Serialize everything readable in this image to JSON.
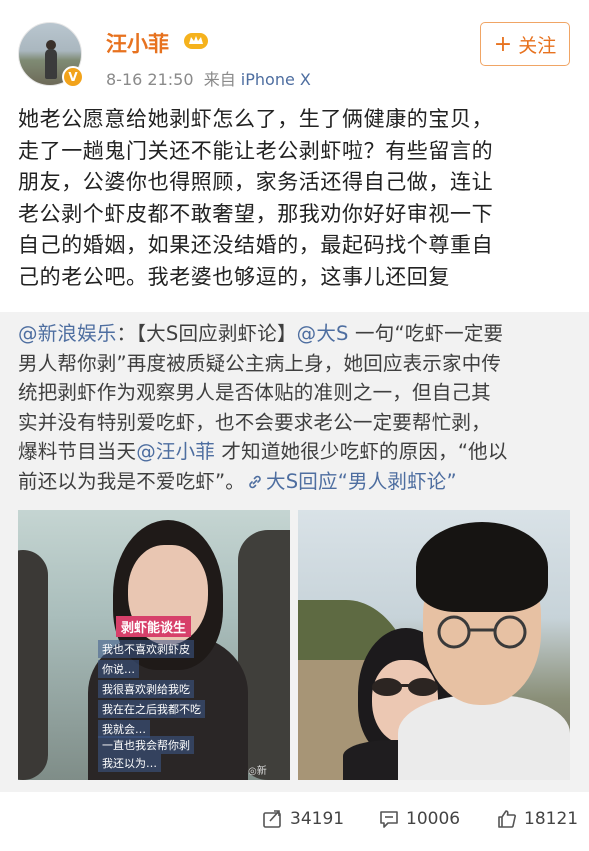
{
  "post": {
    "username": "汪小菲",
    "time": "8-16 21:50",
    "source_prefix": "来自",
    "source": "iPhone X",
    "follow_label": "关注",
    "text_lines": [
      "她老公愿意给她剥虾怎么了，生了俩健康的宝贝，",
      "走了一趟鬼门关还不能让老公剥虾啦？有些留言的",
      "朋友，公婆你也得照顾，家务活还得自己做，连让",
      "老公剥个虾皮都不敢奢望，那我劝你好好审视一下",
      "自己的婚姻，如果还没结婚的，最起码找个尊重自",
      "己的老公吧。我老婆也够逗的，这事儿还回复"
    ]
  },
  "retweet": {
    "author": "@新浪娱乐",
    "colon": "：【大S回应剥虾论】",
    "mention_1": "@大S",
    "seg_1": " 一句“吃虾一定要",
    "line_2": "男人帮你剥”再度被质疑公主病上身，她回应表示家中传",
    "line_3": "统把剥虾作为观察男人是否体贴的准则之一，但自己其",
    "line_4": "实并没有特别爱吃虾，也不会要求老公一定要帮忙剥，",
    "line_5_a": "爆料节目当天",
    "mention_2": "@汪小菲",
    "line_5_b": " 才知道她很少吃虾的原因，“他以",
    "line_6_a": "前还以为我是不爱吃虾”。",
    "topic_link": "大S回应“男人剥虾论”",
    "image_left": {
      "pink_caption": "剥虾能谈生",
      "subtitles": [
        "我也不喜欢剥虾皮",
        "你说…",
        "我很喜欢剥给我吃",
        "我在在之后我都不吃",
        "我就会…",
        "一直也我会帮你剥",
        "我还以为…"
      ],
      "watermark": "◎新"
    }
  },
  "footer": {
    "repost_count": "34191",
    "comment_count": "10006",
    "like_count": "18121"
  },
  "colors": {
    "username": "#e7721f",
    "link": "#4e6ea0",
    "retweet_bg": "#f2f2f2",
    "badge": "#f2a31b"
  },
  "icons": [
    "avatar",
    "vip-badge-icon",
    "crown-icon",
    "plus-icon",
    "link-icon",
    "repost-icon",
    "comment-icon",
    "like-icon"
  ]
}
